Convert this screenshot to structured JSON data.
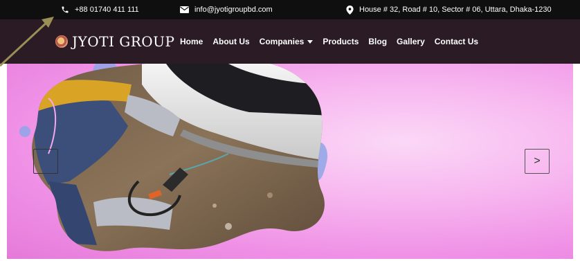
{
  "topbar": {
    "phone": "+88 01740 411 111",
    "email": "info@jyotigroupbd.com",
    "address": "House # 32, Road # 10, Sector # 06, Uttara, Dhaka-1230",
    "phone_icon": "phone-icon",
    "email_icon": "envelope-icon",
    "address_icon": "map-pin-icon"
  },
  "brand": {
    "name": "JYOTI GROUP"
  },
  "nav": {
    "items": [
      {
        "label": "Home"
      },
      {
        "label": "About Us"
      },
      {
        "label": "Companies"
      },
      {
        "label": "Products"
      },
      {
        "label": "Blog"
      },
      {
        "label": "Gallery"
      },
      {
        "label": "Contact Us"
      }
    ]
  },
  "slider": {
    "next_label": ">"
  },
  "colors": {
    "topbar_bg": "#0f0f0f",
    "nav_bg": "#2a1b25",
    "hero_pink": "#f7b6ef",
    "blob_accent": "#8fa4e6",
    "annotation_arrow": "#9a8f55"
  }
}
